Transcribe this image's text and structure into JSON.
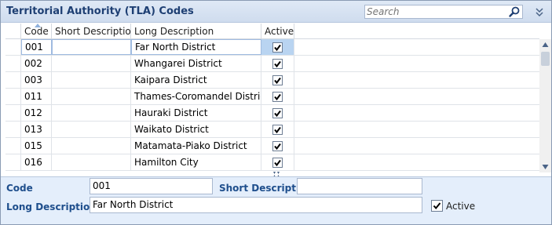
{
  "header": {
    "title": "Territorial Authority (TLA) Codes",
    "search_placeholder": "Search",
    "search_icon": "magnifier-icon",
    "collapse_icon": "double-chevron-down-icon"
  },
  "grid": {
    "columns": [
      "Code",
      "Short Description",
      "Long Description",
      "Active"
    ],
    "sorted_column": "Code",
    "rows": [
      {
        "code": "001",
        "short": "",
        "long": "Far North District",
        "active": true,
        "selected": true
      },
      {
        "code": "002",
        "short": "",
        "long": "Whangarei District",
        "active": true
      },
      {
        "code": "003",
        "short": "",
        "long": "Kaipara District",
        "active": true
      },
      {
        "code": "011",
        "short": "",
        "long": "Thames-Coromandel District",
        "active": true
      },
      {
        "code": "012",
        "short": "",
        "long": "Hauraki District",
        "active": true
      },
      {
        "code": "013",
        "short": "",
        "long": "Waikato District",
        "active": true
      },
      {
        "code": "015",
        "short": "",
        "long": "Matamata-Piako District",
        "active": true
      },
      {
        "code": "016",
        "short": "",
        "long": "Hamilton City",
        "active": true
      }
    ]
  },
  "detail": {
    "code_label": "Code",
    "code_value": "001",
    "short_label": "Short Description",
    "short_value": "",
    "long_label": "Long Description",
    "long_value": "Far North District",
    "active_label": "Active",
    "active_checked": true
  },
  "colors": {
    "title_text": "#1e3f73",
    "label_text": "#1e4e8c",
    "selected_cell": "#b9d4f1",
    "detail_background": "#e4eefb"
  }
}
